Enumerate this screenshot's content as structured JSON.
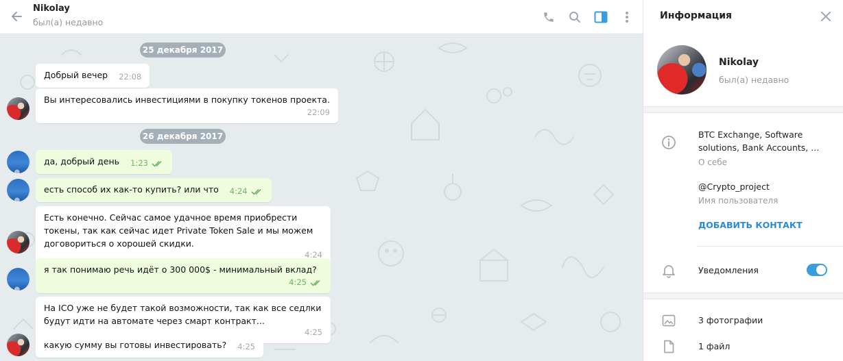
{
  "header": {
    "name": "Nikolay",
    "status": "был(а) недавно"
  },
  "chat": {
    "dates": [
      "25 декабря 2017",
      "26 декабря 2017"
    ],
    "messages": [
      {
        "dir": "in",
        "text": "Добрый вечер",
        "time": "22:08"
      },
      {
        "dir": "in",
        "text": "Вы интересовались инвестициями в покупку токенов проекта.",
        "time": "22:09"
      },
      {
        "dir": "out",
        "text": "да, добрый день",
        "time": "1:23",
        "read": true
      },
      {
        "dir": "out",
        "text": "есть способ их как-то купить? или что",
        "time": "4:24",
        "read": true
      },
      {
        "dir": "in",
        "text": "Есть конечно. Сейчас самое удачное время приобрести токены, так как сейчас идет Private Token Sale и мы можем договориться о хорошей скидки.",
        "time": "4:24"
      },
      {
        "dir": "out",
        "text": "я так понимаю речь идёт о 300 000$ - минимальный вклад?",
        "time": "4:25",
        "read": true
      },
      {
        "dir": "in",
        "text": "На  ICO уже не будет такой возможности, так как все седлки будут идти на автомате через смарт контракт...",
        "time": "4:25"
      },
      {
        "dir": "in",
        "text": "какую сумму вы готовы инвестировать?",
        "time": "4:25"
      }
    ]
  },
  "info": {
    "title": "Информация",
    "name": "Nikolay",
    "status": "был(а) недавно",
    "bio": "BTC Exchange, Software solutions, Bank Accounts, ...",
    "bio_label": "О себе",
    "username": "@Crypto_project",
    "username_label": "Имя пользователя",
    "add_contact": "ДОБАВИТЬ КОНТАКТ",
    "notifications_label": "Уведомления",
    "notifications_on": true,
    "photos": "3 фотографии",
    "files": "1 файл"
  },
  "colors": {
    "accent": "#3a9de0",
    "link": "#2a8ccf",
    "incoming_bubble": "#ffffff",
    "outgoing_bubble": "#effdde",
    "chat_background": "#e6ebee"
  }
}
